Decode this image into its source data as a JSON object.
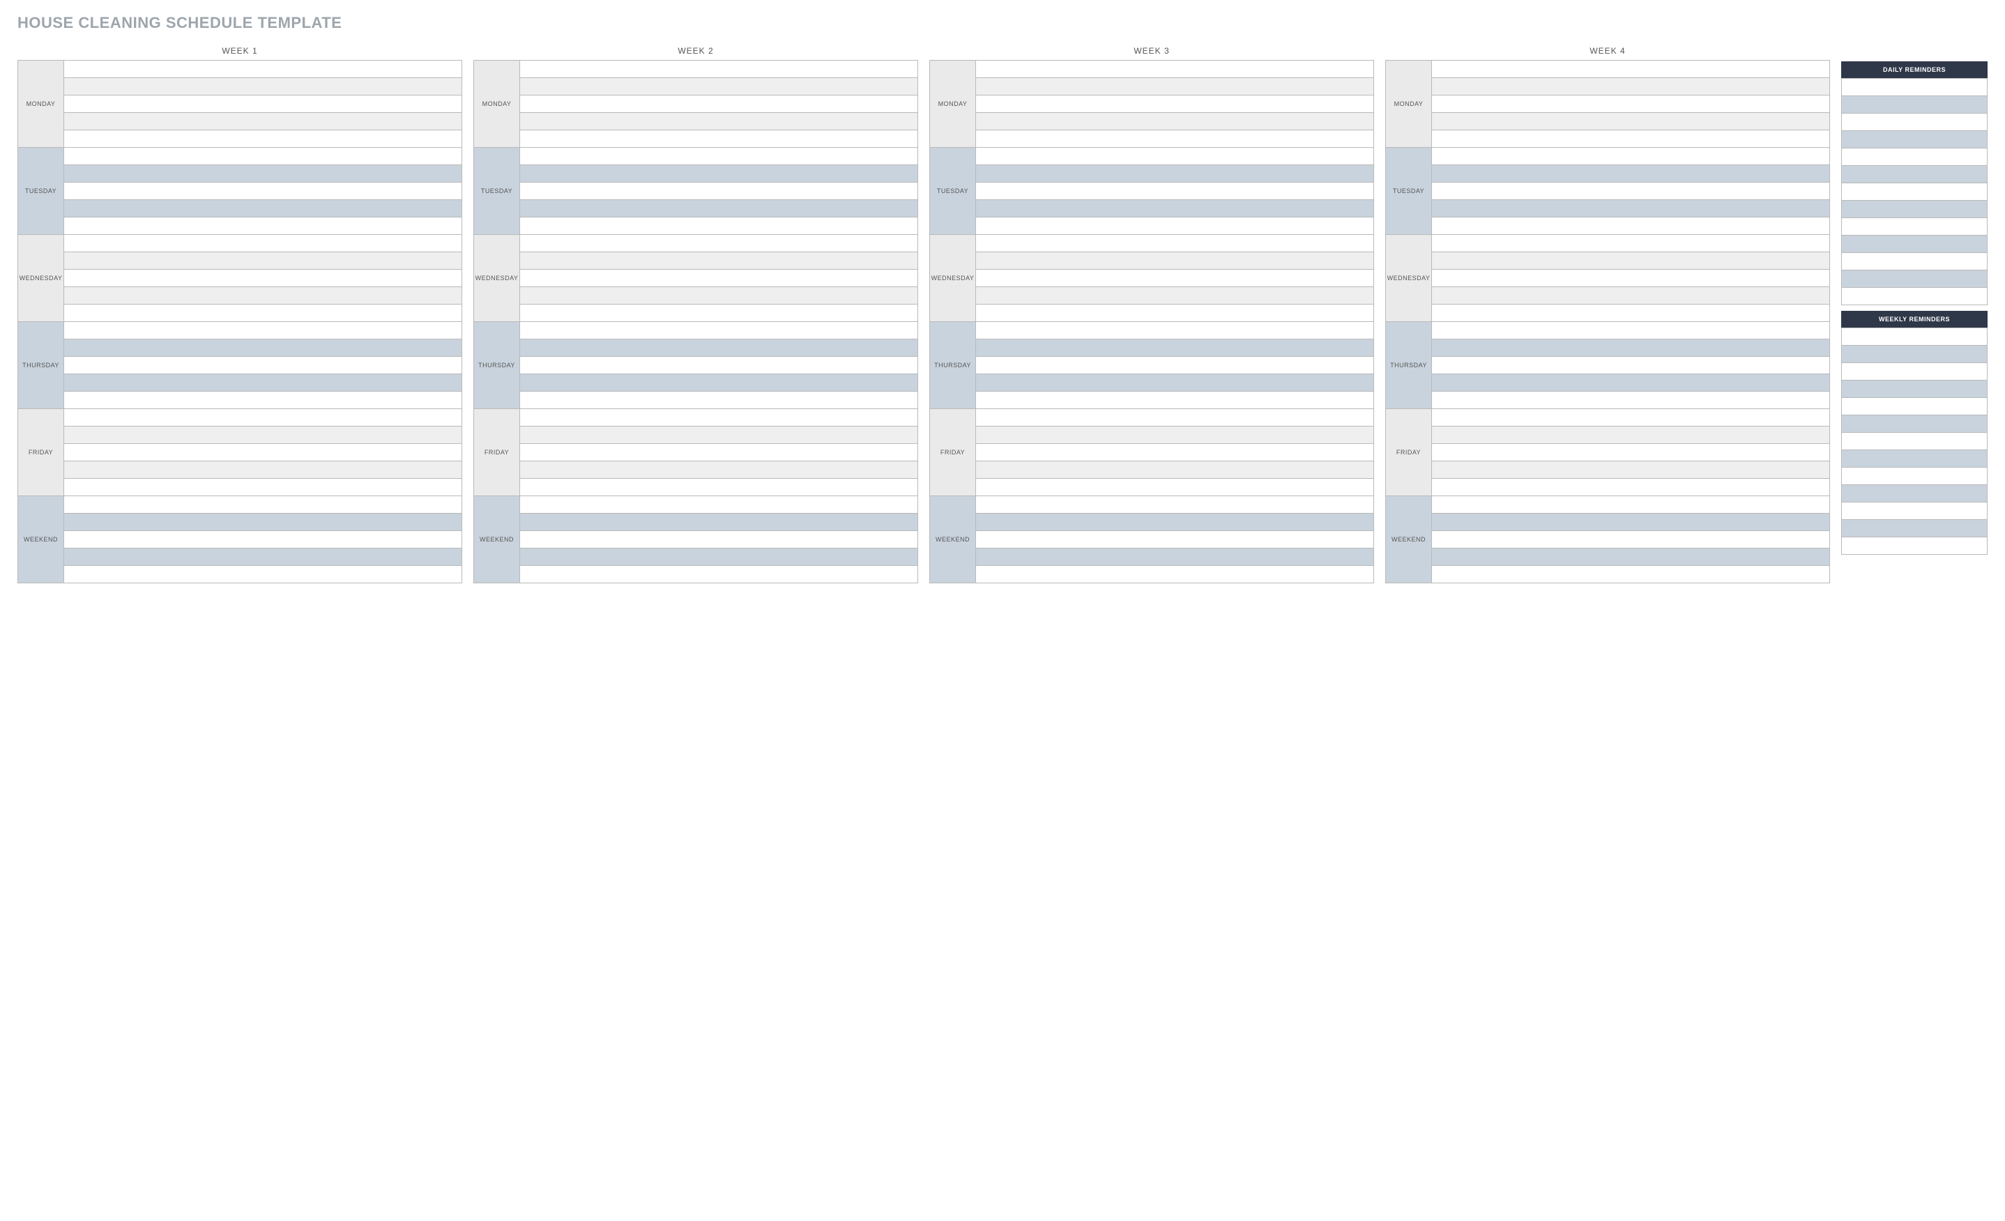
{
  "title": "HOUSE CLEANING SCHEDULE TEMPLATE",
  "weeks": [
    {
      "label": "WEEK 1"
    },
    {
      "label": "WEEK 2"
    },
    {
      "label": "WEEK 3"
    },
    {
      "label": "WEEK 4"
    }
  ],
  "days": [
    {
      "label": "MONDAY"
    },
    {
      "label": "TUESDAY"
    },
    {
      "label": "WEDNESDAY"
    },
    {
      "label": "THURSDAY"
    },
    {
      "label": "FRIDAY"
    },
    {
      "label": "WEEKEND"
    }
  ],
  "rowsPerDay": 5,
  "reminders": {
    "daily": {
      "title": "DAILY REMINDERS",
      "rows": 13
    },
    "weekly": {
      "title": "WEEKLY REMINDERS",
      "rows": 13
    }
  }
}
